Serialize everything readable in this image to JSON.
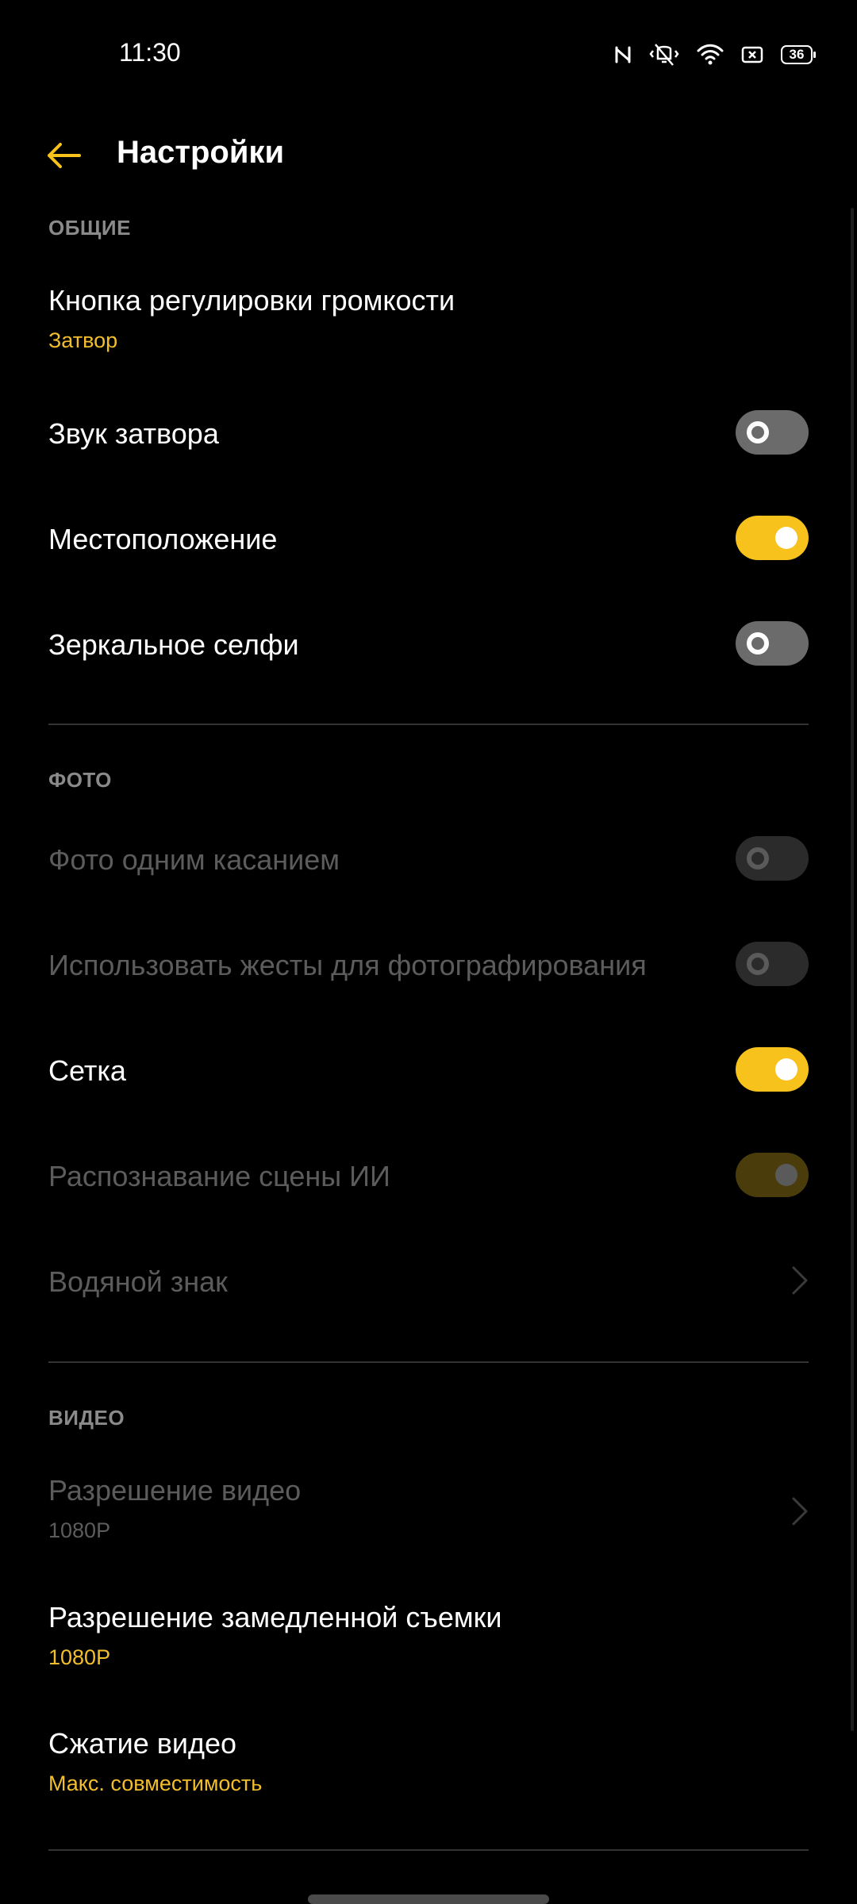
{
  "status_bar": {
    "time": "11:30",
    "battery_level": "36",
    "icons": [
      "nfc-icon",
      "vibrate-icon",
      "wifi-icon",
      "screen-record-icon",
      "battery-icon"
    ]
  },
  "header": {
    "back_icon": "arrow-left-icon",
    "title": "Настройки"
  },
  "colors": {
    "accent": "#f7c21b",
    "background": "#000000",
    "secondary_text": "#8a8a8a",
    "disabled_text": "#5c5c5c"
  },
  "sections": {
    "general": {
      "header": "ОБЩИЕ",
      "volume_button": {
        "label": "Кнопка регулировки громкости",
        "value": "Затвор"
      },
      "shutter_sound": {
        "label": "Звук затвора",
        "state": "off"
      },
      "location": {
        "label": "Местоположение",
        "state": "on"
      },
      "mirror_selfie": {
        "label": "Зеркальное селфи",
        "state": "off"
      }
    },
    "photo": {
      "header": "ФОТО",
      "one_touch": {
        "label": "Фото одним касанием",
        "state": "off",
        "enabled": false
      },
      "gestures": {
        "label": "Использовать жесты для фотографирования",
        "state": "off",
        "enabled": false
      },
      "grid": {
        "label": "Сетка",
        "state": "on"
      },
      "ai_scene": {
        "label": "Распознавание сцены ИИ",
        "state": "on",
        "enabled": false
      },
      "watermark": {
        "label": "Водяной знак",
        "enabled": false
      }
    },
    "video": {
      "header": "ВИДЕО",
      "resolution": {
        "label": "Разрешение видео",
        "value": "1080P",
        "enabled": false
      },
      "slowmo_resolution": {
        "label": "Разрешение замедленной съемки",
        "value": "1080P"
      },
      "compression": {
        "label": "Сжатие видео",
        "value": "Макс. совместимость"
      }
    }
  }
}
